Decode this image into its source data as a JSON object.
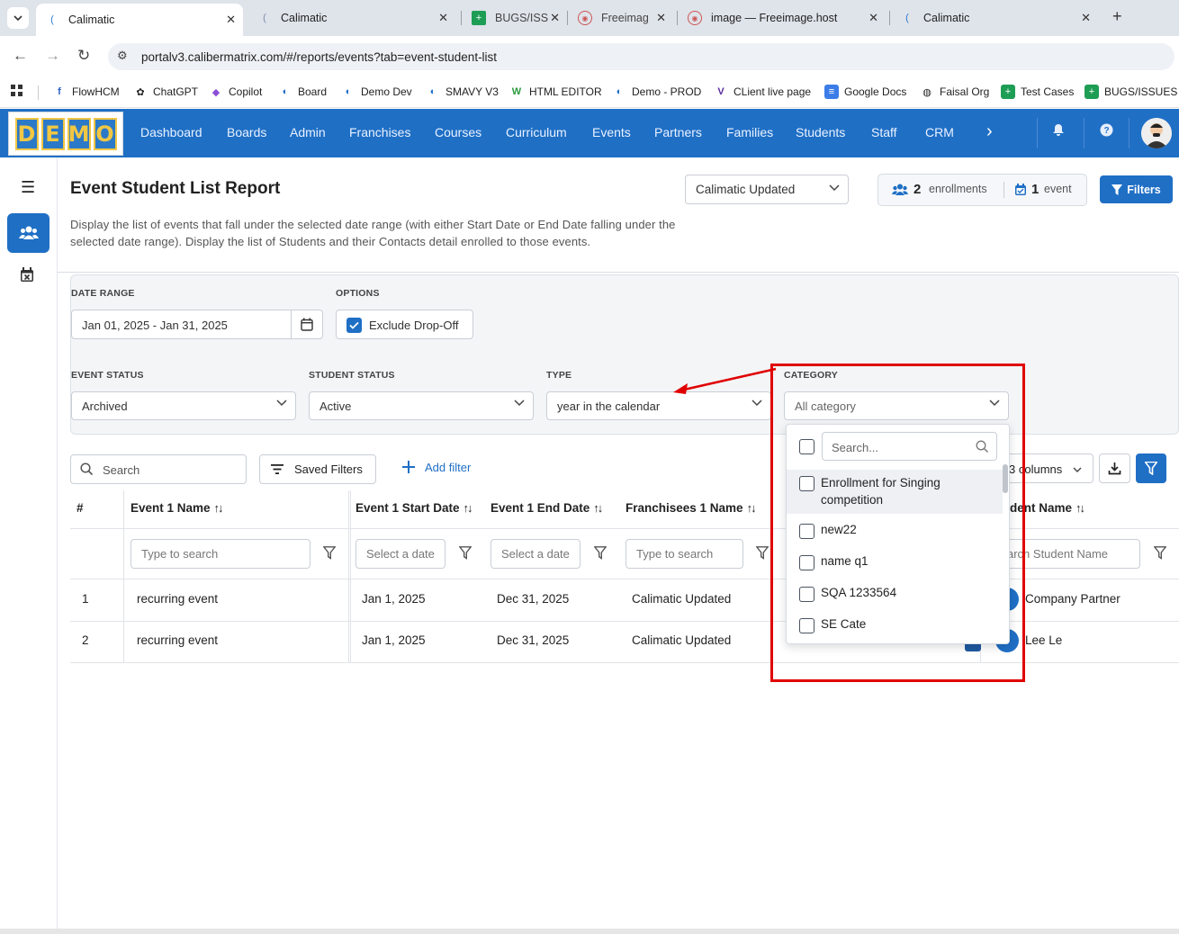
{
  "browser": {
    "tabs": [
      {
        "title": "Calimatic",
        "active": true
      },
      {
        "title": "Calimatic",
        "active": false
      },
      {
        "title": "BUGS/ISS",
        "active": false
      },
      {
        "title": "Freeimag",
        "active": false
      },
      {
        "title": "image — Freeimage.host",
        "active": false
      },
      {
        "title": "Calimatic",
        "active": false
      }
    ],
    "url": "portalv3.calibermatrix.com/#/reports/events?tab=event-student-list",
    "bookmarks": [
      "FlowHCM",
      "ChatGPT",
      "Copilot",
      "Board",
      "Demo Dev",
      "SMAVY V3",
      "HTML EDITOR",
      "Demo - PROD",
      "CLient live page",
      "Google Docs",
      "Faisal Org",
      "Test Cases",
      "BUGS/ISSUES"
    ]
  },
  "app": {
    "logo_letters": [
      "D",
      "E",
      "M",
      "O"
    ],
    "menu": [
      "Dashboard",
      "Boards",
      "Admin",
      "Franchises",
      "Courses",
      "Curriculum",
      "Events",
      "Partners",
      "Families",
      "Students",
      "Staff",
      "CRM"
    ]
  },
  "page": {
    "title": "Event Student List Report",
    "description": "Display the list of events that fall under the selected date range (with either Start Date or End Date falling under the selected date range). Display the list of Students and their Contacts detail enrolled to those events.",
    "org_select": "Calimatic Updated",
    "stats": {
      "enrollments_count": "2",
      "enrollments_label": "enrollments",
      "events_count": "1",
      "events_label": "event"
    },
    "filters_button": "Filters"
  },
  "filters": {
    "date_range_label": "DATE RANGE",
    "date_range_value": "Jan 01, 2025 - Jan 31, 2025",
    "options_label": "OPTIONS",
    "exclude_dropoff": "Exclude Drop-Off",
    "event_status_label": "EVENT STATUS",
    "event_status_value": "Archived",
    "student_status_label": "STUDENT STATUS",
    "student_status_value": "Active",
    "type_label": "TYPE",
    "type_value": "year in the calendar",
    "category_label": "CATEGORY",
    "category_value": "All category"
  },
  "toolbar": {
    "search_placeholder": "Search",
    "saved_filters": "Saved Filters",
    "add_filter": "Add filter",
    "columns": "3 columns"
  },
  "table": {
    "headers": {
      "num": "#",
      "event_name": "Event 1 Name",
      "start_date": "Event 1 Start Date",
      "end_date": "Event 1 End Date",
      "franchisee": "Franchisees 1 Name",
      "student_name": "dent Name"
    },
    "col_filters": {
      "event_name": "Type to search",
      "start_date": "Select a date",
      "end_date": "Select a date",
      "franchisee": "Type to search",
      "student_name": "arch Student Name"
    },
    "rows": [
      {
        "num": "1",
        "event_name": "recurring event",
        "start": "Jan 1, 2025",
        "end": "Dec 31, 2025",
        "franchisee": "Calimatic Updated",
        "student": "Company Partner"
      },
      {
        "num": "2",
        "event_name": "recurring event",
        "start": "Jan 1, 2025",
        "end": "Dec 31, 2025",
        "franchisee": "Calimatic Updated",
        "student": "Lee Le"
      }
    ]
  },
  "category_dropdown": {
    "search_placeholder": "Search...",
    "options": [
      "Enrollment for Singing competition",
      "new22",
      "name q1",
      "SQA 1233564",
      "SE Cate"
    ]
  },
  "colors": {
    "primary": "#1f6fc5",
    "annotation": "#e00000"
  }
}
